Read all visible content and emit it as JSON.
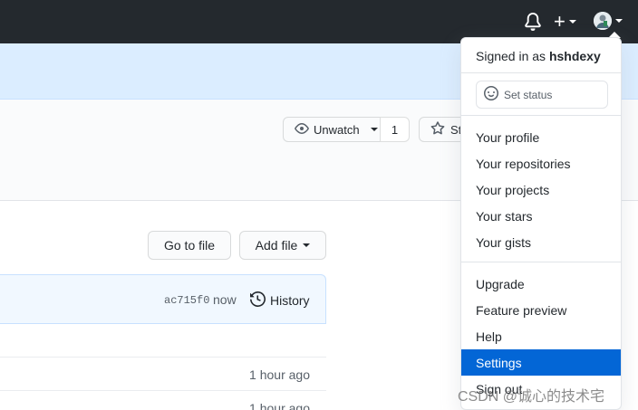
{
  "header": {
    "notification_icon": "bell-icon",
    "create_icon": "plus-icon",
    "create_symbol": "+",
    "avatar_icon": "avatar"
  },
  "repo": {
    "unwatch_label": "Unwatch",
    "unwatch_count": "1",
    "star_label": "Star"
  },
  "file_nav": {
    "go_to_file": "Go to file",
    "add_file": "Add file"
  },
  "commit": {
    "sha": "ac715f0",
    "time": "now",
    "history_label": "History"
  },
  "rows": [
    {
      "time": ""
    },
    {
      "time": "1 hour ago"
    },
    {
      "time": "1 hour ago"
    }
  ],
  "menu": {
    "signed_in_prefix": "Signed in as",
    "username": "hshdexy",
    "set_status": "Set status",
    "items_group1": [
      "Your profile",
      "Your repositories",
      "Your projects",
      "Your stars",
      "Your gists"
    ],
    "items_group2": [
      "Upgrade",
      "Feature preview",
      "Help",
      "Settings",
      "Sign out"
    ],
    "active_item": "Settings"
  },
  "watermark": "CSDN @诚心的技术宅",
  "colors": {
    "header_bg": "#24292e",
    "accent": "#0366d6",
    "flash_bg": "#dbedff",
    "commit_bg": "#f1f8ff"
  }
}
